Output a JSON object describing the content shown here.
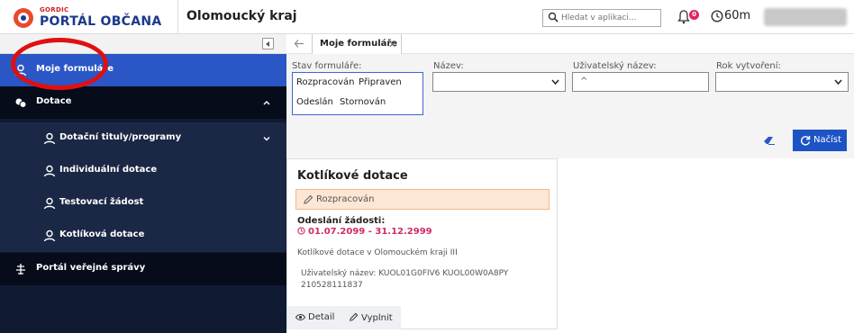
{
  "header": {
    "logo_small": "GORDIC",
    "logo_big": "PORTÁL OBČANA",
    "org_name": "Olomoucký kraj",
    "search_placeholder": "Hledat v aplikaci...",
    "notif_count": "0",
    "session_timer": "60m"
  },
  "sidebar": {
    "items": [
      {
        "label": "Moje formuláře",
        "icon": "user-icon"
      },
      {
        "label": "Dotace",
        "icon": "coins-icon"
      },
      {
        "label": "Dotační tituly/programy",
        "icon": "user-icon"
      },
      {
        "label": "Individuální dotace",
        "icon": "user-icon"
      },
      {
        "label": "Testovací žádost",
        "icon": "user-icon"
      },
      {
        "label": "Kotlíková dotace",
        "icon": "user-icon"
      },
      {
        "label": "Portál veřejné správy",
        "icon": "emblem-icon"
      }
    ]
  },
  "tab": {
    "label": "Moje formuláře"
  },
  "filters": {
    "status_label": "Stav formuláře:",
    "status_options": [
      "Rozpracován",
      "Připraven",
      "Odeslán",
      "Stornován"
    ],
    "name_label": "Název:",
    "username_label": "Uživatelský název:",
    "username_value": "^",
    "year_label": "Rok vytvoření:",
    "load_button": "Načíst"
  },
  "card": {
    "title": "Kotlíkové dotace",
    "status": "Rozpracován",
    "submission_heading": "Odeslání žádosti:",
    "date_range": "01.07.2099 - 31.12.2999",
    "description": "Kotlíkové dotace v Olomouckém kraji III",
    "user_name": "Uživatelský název: KUOL01G0FIV6 KUOL00W0A8PY 210528111837",
    "detail_label": "Detail",
    "fill_label": "Vyplnit"
  },
  "colors": {
    "sidebar_bg": "#101a33",
    "active_item": "#2a56c6",
    "accent": "#1e53c6",
    "status_bg": "#fde6d3",
    "date_color": "#d02a6a",
    "annotation": "#e01010"
  }
}
